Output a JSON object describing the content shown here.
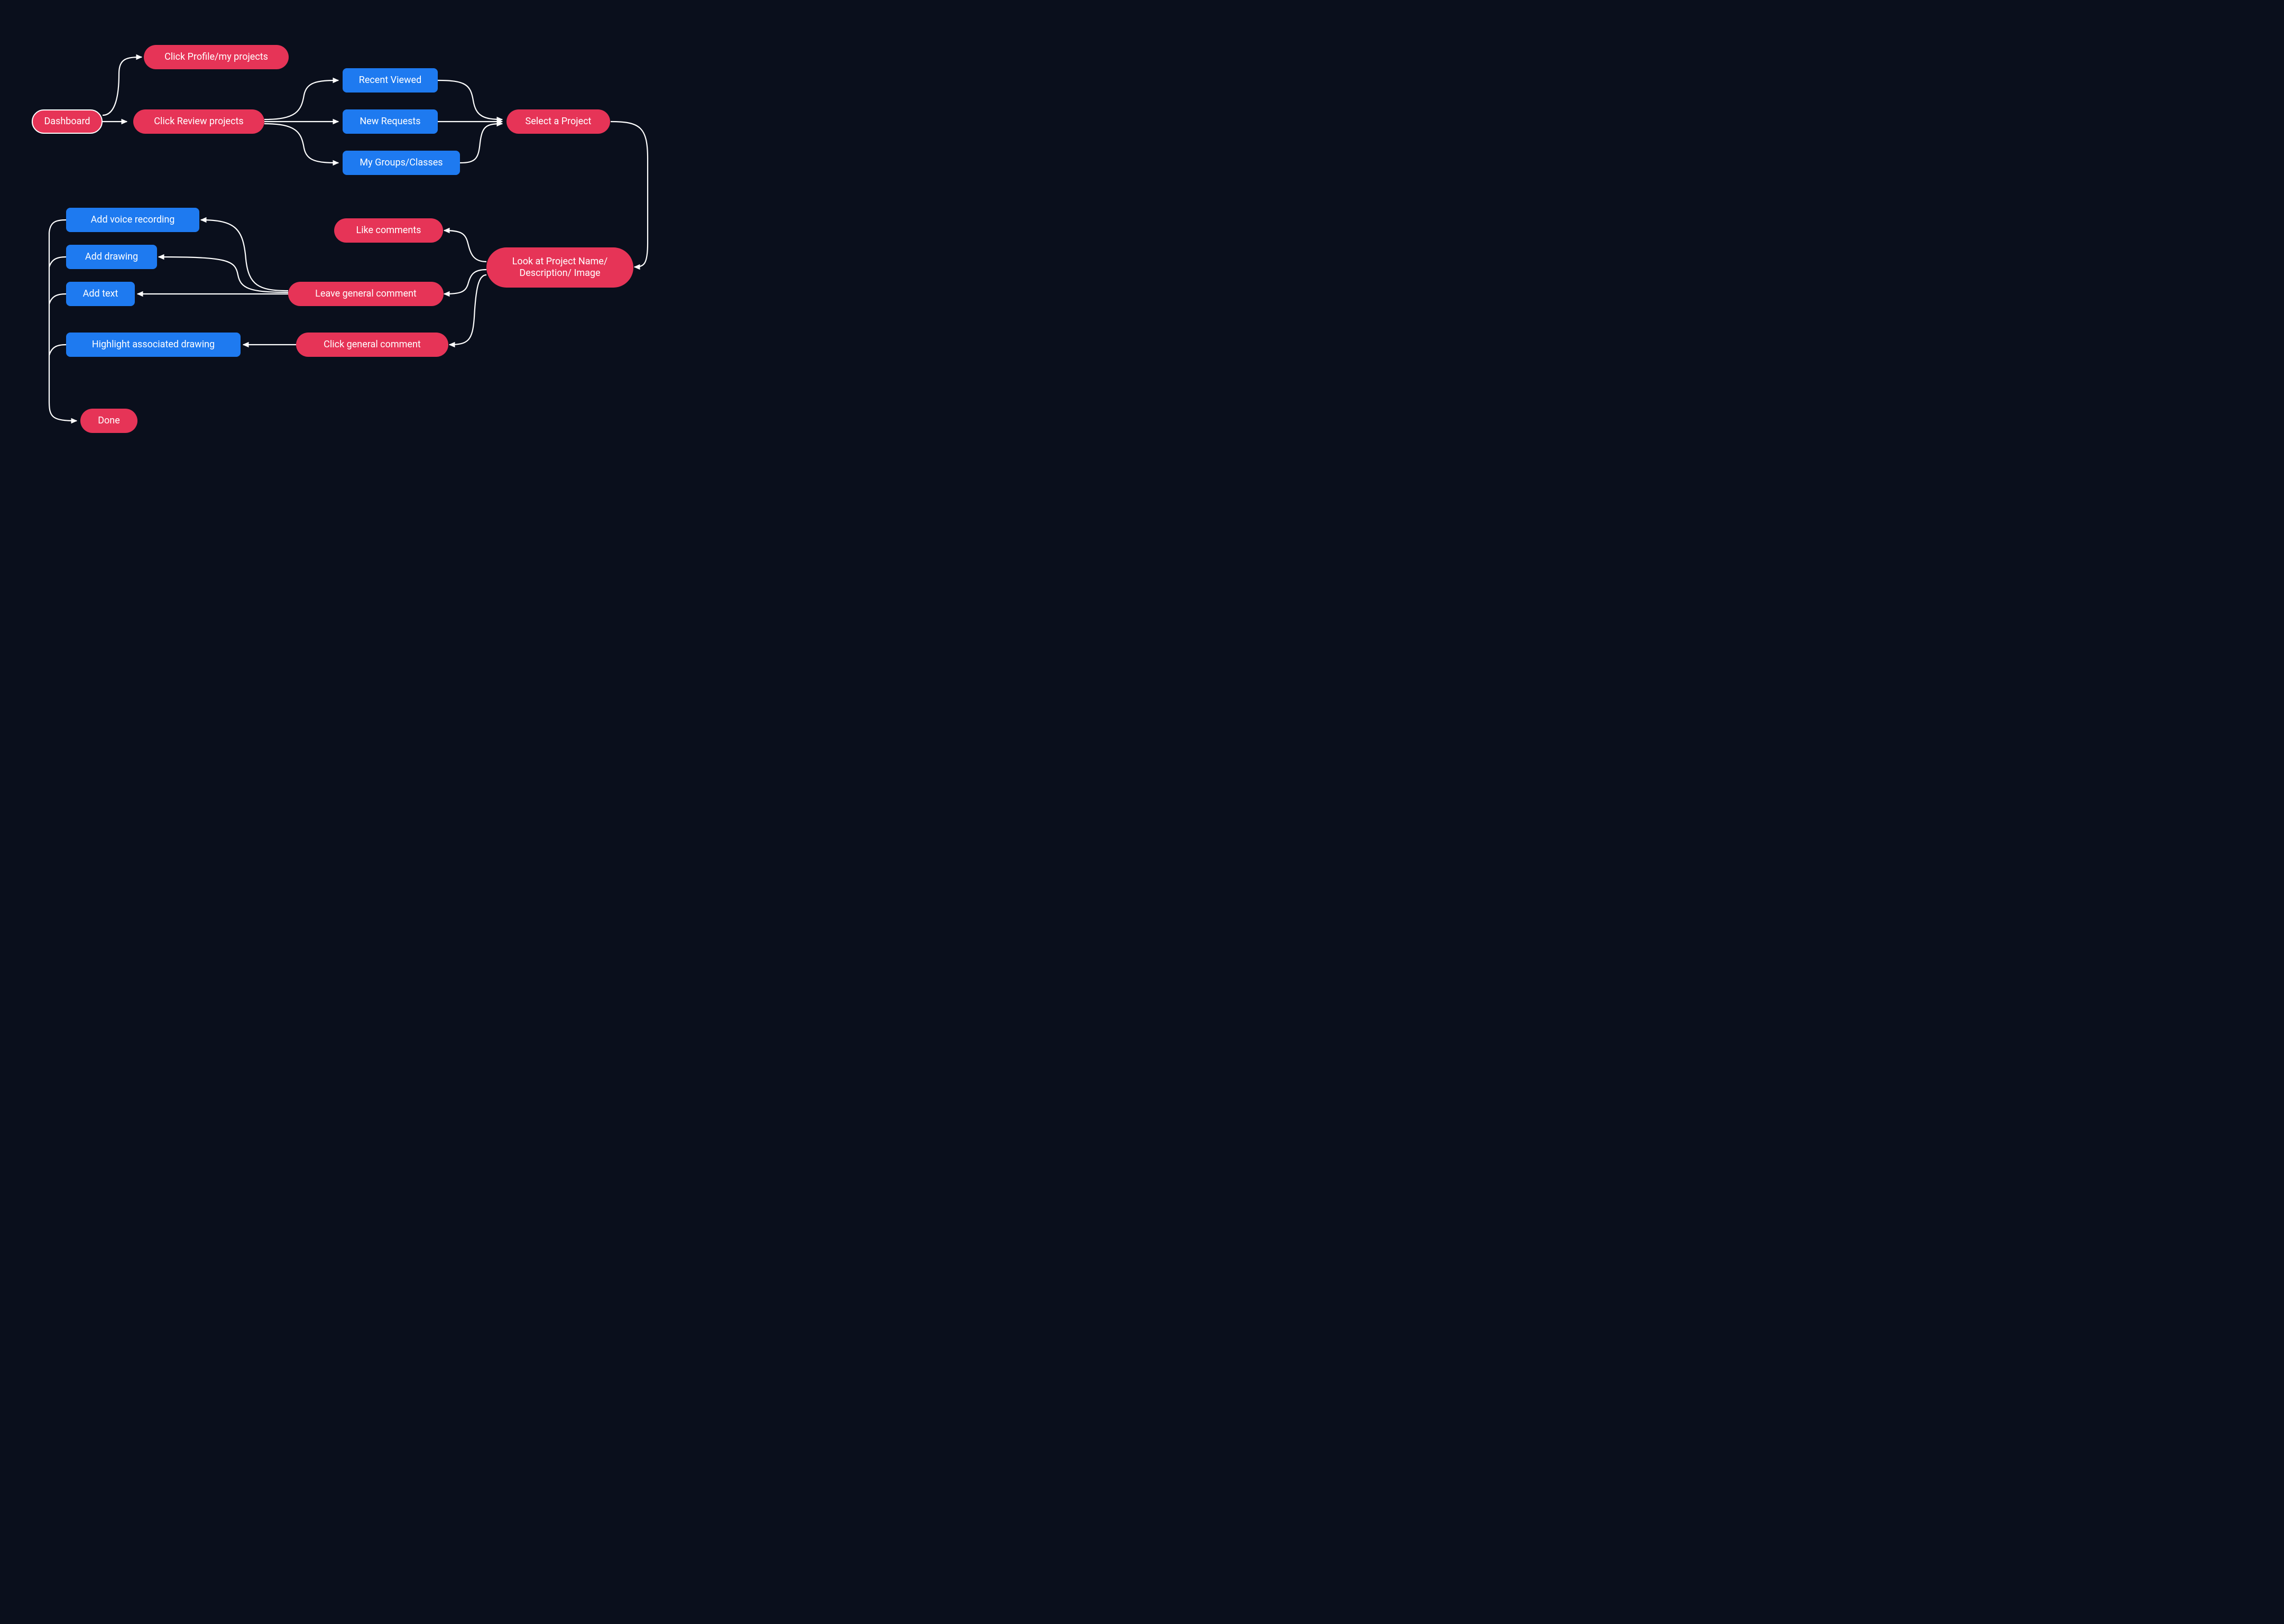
{
  "colors": {
    "background": "#0a0f1c",
    "pill": "#e63457",
    "rect": "#1e7af0",
    "line": "#ffffff",
    "text": "#ffffff"
  },
  "nodes": {
    "dashboard": "Dashboard",
    "clickProfile": "Click Profile/my projects",
    "clickReview": "Click Review projects",
    "recentViewed": "Recent Viewed",
    "newRequests": "New Requests",
    "myGroups": "My Groups/Classes",
    "selectProject": "Select a Project",
    "lookAt": "Look at Project Name/ Description/ Image",
    "likeComments": "Like comments",
    "leaveGeneral": "Leave general comment",
    "clickGeneral": "Click general comment",
    "addVoice": "Add voice recording",
    "addDrawing": "Add drawing",
    "addText": "Add text",
    "highlight": "Highlight associated drawing",
    "done": "Done"
  }
}
